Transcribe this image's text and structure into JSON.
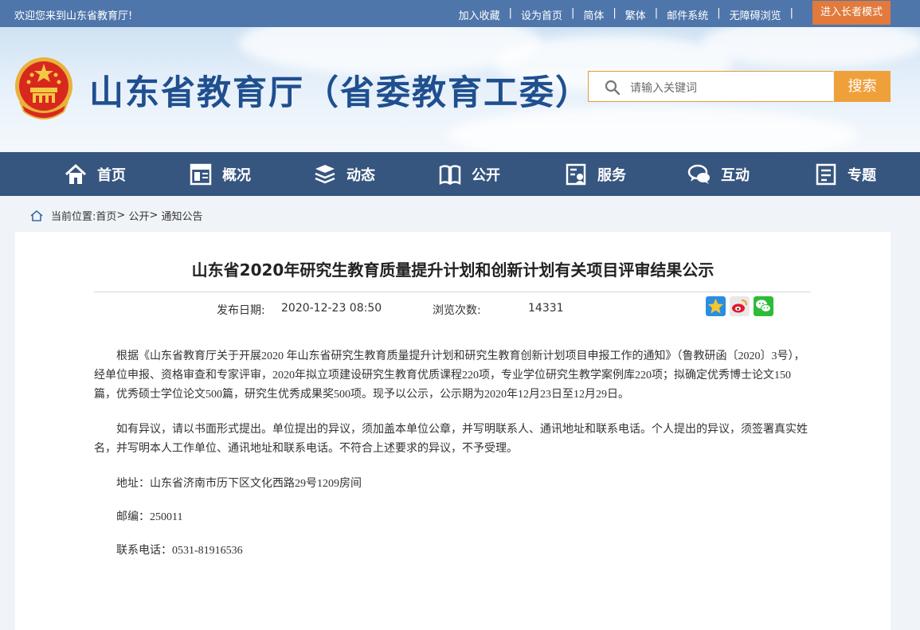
{
  "topbar": {
    "welcome": "欢迎您来到山东省教育厅!",
    "links": [
      "加入收藏",
      "设为首页",
      "简体",
      "繁体",
      "邮件系统",
      "无障碍浏览"
    ],
    "elder_mode": "进入长者模式"
  },
  "header": {
    "title": "山东省教育厅（省委教育工委）",
    "search_placeholder": "请输入关键词",
    "search_button": "搜索"
  },
  "nav": [
    {
      "label": "首页",
      "icon": "home-icon"
    },
    {
      "label": "概况",
      "icon": "overview-icon"
    },
    {
      "label": "动态",
      "icon": "news-icon"
    },
    {
      "label": "公开",
      "icon": "book-icon"
    },
    {
      "label": "服务",
      "icon": "service-icon"
    },
    {
      "label": "互动",
      "icon": "chat-icon"
    },
    {
      "label": "专题",
      "icon": "topic-icon"
    }
  ],
  "breadcrumb": {
    "label": "当前位置:",
    "items": [
      "首页",
      "公开",
      "通知公告"
    ]
  },
  "article": {
    "title": "山东省2020年研究生教育质量提升计划和创新计划有关项目评审结果公示",
    "publish_label": "发布日期:",
    "publish_date": "2020-12-23 08:50",
    "views_label": "浏览次数:",
    "views": "14331",
    "paragraphs": [
      "根据《山东省教育厅关于开展2020 年山东省研究生教育质量提升计划和研究生教育创新计划项目申报工作的通知》（鲁教研函〔2020〕3号），经单位申报、资格审查和专家评审，2020年拟立项建设研究生教育优质课程220项，专业学位研究生教学案例库220项；拟确定优秀博士论文150篇，优秀硕士学位论文500篇，研究生优秀成果奖500项。现予以公示，公示期为2020年12月23日至12月29日。",
      "如有异议，请以书面形式提出。单位提出的异议，须加盖本单位公章，并写明联系人、通讯地址和联系电话。个人提出的异议，须签署真实姓名，并写明本人工作单位、通讯地址和联系电话。不符合上述要求的异议，不予受理。",
      "地址：山东省济南市历下区文化西路29号1209房间",
      "邮编：250011",
      "联系电话：0531-81916536"
    ]
  },
  "colors": {
    "topbar": "#4f76ab",
    "nav": "#36557f",
    "accent": "#f0a03a",
    "title": "#1f4f8f"
  }
}
